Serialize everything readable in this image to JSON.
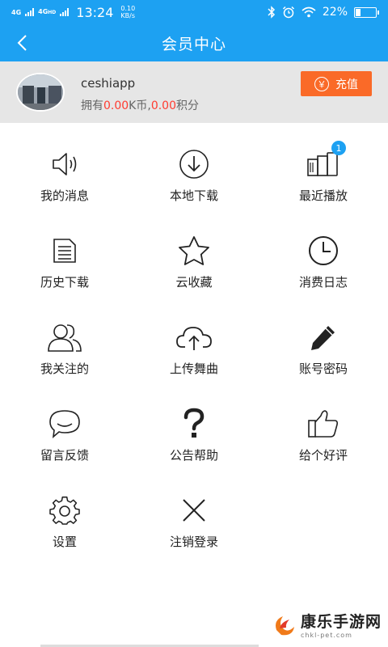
{
  "status_bar": {
    "network_1": "4G",
    "network_2": "4G",
    "network_2_sup": "HD",
    "time": "13:24",
    "speed_value": "0.10",
    "speed_unit": "KB/s",
    "battery": "22%",
    "battery_level": 0.22
  },
  "header": {
    "title": "会员中心"
  },
  "profile": {
    "username": "ceshiapp",
    "assets_prefix": "拥有",
    "k_coins": "0.00",
    "k_coins_unit": "K币,",
    "points": "0.00",
    "points_unit": "积分",
    "recharge_icon": "￥",
    "recharge_label": "充值"
  },
  "menu": [
    {
      "label": "我的消息",
      "icon": "speaker-icon"
    },
    {
      "label": "本地下载",
      "icon": "download-icon"
    },
    {
      "label": "最近播放",
      "icon": "recent-play-icon",
      "badge": "1"
    },
    {
      "label": "历史下载",
      "icon": "document-list-icon"
    },
    {
      "label": "云收藏",
      "icon": "star-icon"
    },
    {
      "label": "消费日志",
      "icon": "clock-icon"
    },
    {
      "label": "我关注的",
      "icon": "users-icon"
    },
    {
      "label": "上传舞曲",
      "icon": "cloud-upload-icon"
    },
    {
      "label": "账号密码",
      "icon": "pencil-icon"
    },
    {
      "label": "留言反馈",
      "icon": "chat-bubble-icon"
    },
    {
      "label": "公告帮助",
      "icon": "question-icon"
    },
    {
      "label": "给个好评",
      "icon": "thumbs-up-icon"
    },
    {
      "label": "设置",
      "icon": "gear-icon"
    },
    {
      "label": "注销登录",
      "icon": "close-icon"
    }
  ],
  "watermark": {
    "title": "康乐手游网",
    "subtitle": "chkl-pet.com"
  }
}
